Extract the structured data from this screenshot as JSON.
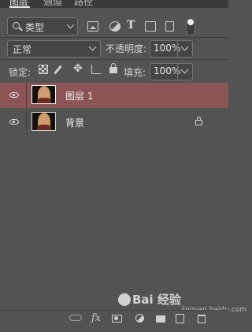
{
  "tabs": [
    {
      "label": "图层",
      "active": true
    },
    {
      "label": "通道",
      "active": false
    },
    {
      "label": "路径",
      "active": false
    }
  ],
  "filter": {
    "kind_label": "类型",
    "icons": [
      "image-filter-icon",
      "adjustment-filter-icon",
      "type-filter-icon",
      "shape-filter-icon",
      "smart-object-filter-icon"
    ]
  },
  "blend": {
    "mode": "正常",
    "opacity_label": "不透明度:",
    "opacity_value": "100%"
  },
  "lock": {
    "label": "锁定:",
    "fill_label": "填充:",
    "fill_value": "100%"
  },
  "layers": [
    {
      "name": "图层 1",
      "selected": true,
      "visible": true,
      "locked": false
    },
    {
      "name": "背景",
      "selected": false,
      "visible": true,
      "locked": true
    }
  ],
  "footer": {
    "fx_label": "fx"
  },
  "watermark": {
    "text": "Bai 经验",
    "sub": "jingyan.baidu.com"
  },
  "colors": {
    "panel": "#535353",
    "selected_row": "#8d5456"
  }
}
